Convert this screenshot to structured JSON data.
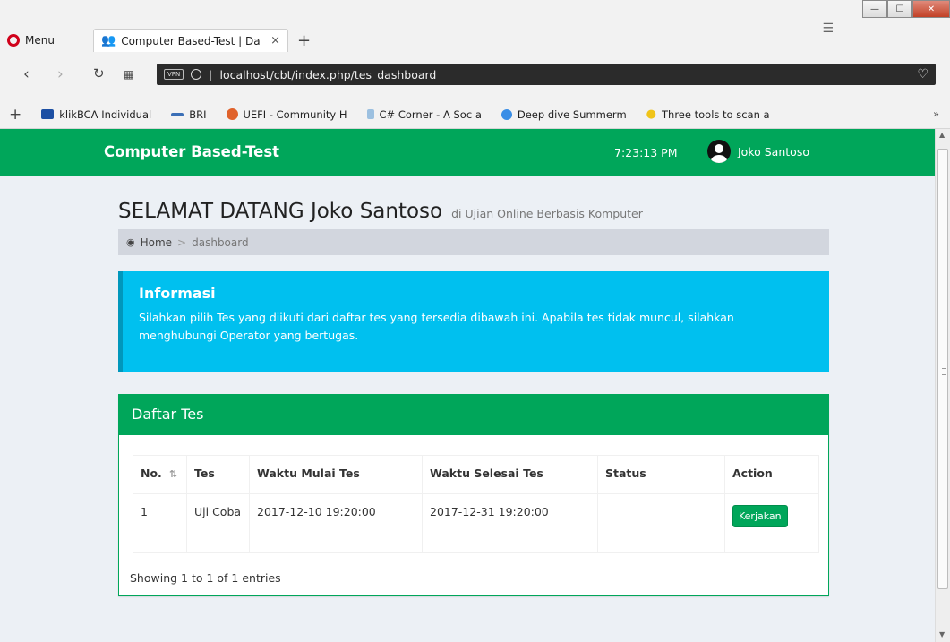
{
  "browser": {
    "menu_label": "Menu",
    "tab_title": "Computer Based-Test | Da",
    "tab_close": "×",
    "new_tab": "+",
    "tab_menu_glyph": "☰",
    "url": "localhost/cbt/index.php/tes_dashboard",
    "vpn_label": "VPN",
    "window_minimize": "—",
    "window_maximize": "☐",
    "window_close": "✕"
  },
  "bookmarks": {
    "add": "+",
    "items": [
      {
        "label": "klikBCA Individual",
        "color": "#1c4fa3"
      },
      {
        "label": "BRI",
        "color": "#3b6fb6"
      },
      {
        "label": "UEFI - Community H",
        "color": "#e0622b"
      },
      {
        "label": "C# Corner - A Soc a",
        "color": "#9cc0e0"
      },
      {
        "label": "Deep dive Summerm",
        "color": "#3a8ee6"
      },
      {
        "label": "Three tools to scan a",
        "color": "#f0c419"
      }
    ],
    "more": "»"
  },
  "app": {
    "brand": "Computer Based-Test",
    "clock": "7:23:13 PM",
    "user_name": "Joko Santoso",
    "accent_color": "#00a65a",
    "info_color": "#00c0ef"
  },
  "page": {
    "title": "SELAMAT DATANG Joko Santoso",
    "subtitle": "di Ujian Online Berbasis Komputer",
    "breadcrumb_home": "Home",
    "breadcrumb_sep": ">",
    "breadcrumb_current": "dashboard"
  },
  "info": {
    "title": "Informasi",
    "text": "Silahkan pilih Tes yang diikuti dari daftar tes yang tersedia dibawah ini. Apabila tes tidak muncul, silahkan menghubungi Operator yang bertugas."
  },
  "test_list": {
    "title": "Daftar Tes",
    "columns": [
      "No.",
      "Tes",
      "Waktu Mulai Tes",
      "Waktu Selesai Tes",
      "Status",
      "Action"
    ],
    "rows": [
      {
        "no": "1",
        "tes": "Uji Coba",
        "start": "2017-12-10 19:20:00",
        "end": "2017-12-31 19:20:00",
        "status": "",
        "action": "Kerjakan"
      }
    ],
    "info": "Showing 1 to 1 of 1 entries"
  }
}
